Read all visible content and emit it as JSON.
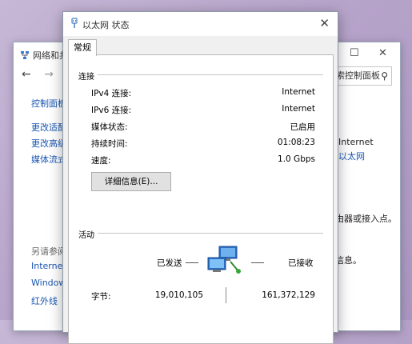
{
  "background_window": {
    "title": "网络和共",
    "controls": {
      "minimize": "—",
      "maximize": "☐",
      "close": "✕"
    },
    "nav": {
      "back": "←",
      "forward": "→"
    },
    "search_text": "搜索控制面板",
    "sidebar": {
      "home": "控制面板",
      "links": [
        "更改适配",
        "更改高级",
        "媒体流式"
      ],
      "see_also_title": "另请参阅",
      "see_also": [
        "Internet",
        "Window",
        "红外线"
      ]
    },
    "right_texts": {
      "internet": "Internet",
      "ethernet": "以太网",
      "router": "由器或接入点。",
      "info": "信息。"
    }
  },
  "dialog": {
    "title": "以太网 状态",
    "close_icon": "✕",
    "tab_general": "常规",
    "connection": {
      "group_label": "连接",
      "rows": [
        {
          "label": "IPv4 连接:",
          "value": "Internet"
        },
        {
          "label": "IPv6 连接:",
          "value": "Internet"
        },
        {
          "label": "媒体状态:",
          "value": "已启用"
        },
        {
          "label": "持续时间:",
          "value": "01:08:23"
        },
        {
          "label": "速度:",
          "value": "1.0 Gbps"
        }
      ],
      "details_button": "详细信息(E)..."
    },
    "activity": {
      "group_label": "活动",
      "sent_label": "已发送",
      "received_label": "已接收",
      "bytes_label": "字节:",
      "bytes_sent": "19,010,105",
      "bytes_received": "161,372,129"
    }
  },
  "colors": {
    "link": "#1a56b0",
    "dialog_bg": "#f0f0f0",
    "panel_bg": "#ffffff"
  }
}
